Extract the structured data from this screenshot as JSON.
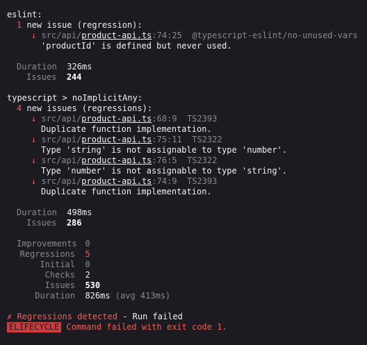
{
  "eslint": {
    "header": "eslint:",
    "count": "1",
    "summary": " new issue (regression):",
    "issues": [
      {
        "arrow": "↓",
        "path_prefix": "src/api/",
        "file": "product-api.ts",
        "pos": ":74:25",
        "code": "@typescript-eslint/no-unused-vars",
        "message": "'productId' is defined but never used."
      }
    ],
    "duration_label": "Duration",
    "duration_value": "326ms",
    "issues_label": "Issues",
    "issues_value": "244"
  },
  "typescript": {
    "header": "typescript > noImplicitAny:",
    "count": "4",
    "summary": " new issues (regressions):",
    "issues": [
      {
        "arrow": "↓",
        "path_prefix": "src/api/",
        "file": "product-api.ts",
        "pos": ":68:9",
        "code": "TS2393",
        "message": "Duplicate function implementation."
      },
      {
        "arrow": "↓",
        "path_prefix": "src/api/",
        "file": "product-api.ts",
        "pos": ":75:11",
        "code": "TS2322",
        "message": "Type 'string' is not assignable to type 'number'."
      },
      {
        "arrow": "↓",
        "path_prefix": "src/api/",
        "file": "product-api.ts",
        "pos": ":76:5",
        "code": "TS2322",
        "message": "Type 'number' is not assignable to type 'string'."
      },
      {
        "arrow": "↓",
        "path_prefix": "src/api/",
        "file": "product-api.ts",
        "pos": ":74:9",
        "code": "TS2393",
        "message": "Duplicate function implementation."
      }
    ],
    "duration_label": "Duration",
    "duration_value": "498ms",
    "issues_label": "Issues",
    "issues_value": "286"
  },
  "totals": {
    "improvements_label": "Improvements",
    "improvements_value": "0",
    "regressions_label": "Regressions",
    "regressions_value": "5",
    "initial_label": "Initial",
    "initial_value": "0",
    "checks_label": "Checks",
    "checks_value": "2",
    "issues_label": "Issues",
    "issues_value": "530",
    "duration_label": "Duration",
    "duration_value": "826ms",
    "duration_avg": " (avg 413ms)"
  },
  "result": {
    "cross": "✗",
    "regressions_text": " Regressions detected",
    "run_text": " - Run failed",
    "badge": "ELIFECYCLE",
    "error_text": " Command failed with exit code 1."
  },
  "colors": {
    "background": "#1c1b22",
    "error": "#f25c54",
    "dim": "#8a8a8a",
    "badge_bg": "#d23a3a"
  }
}
